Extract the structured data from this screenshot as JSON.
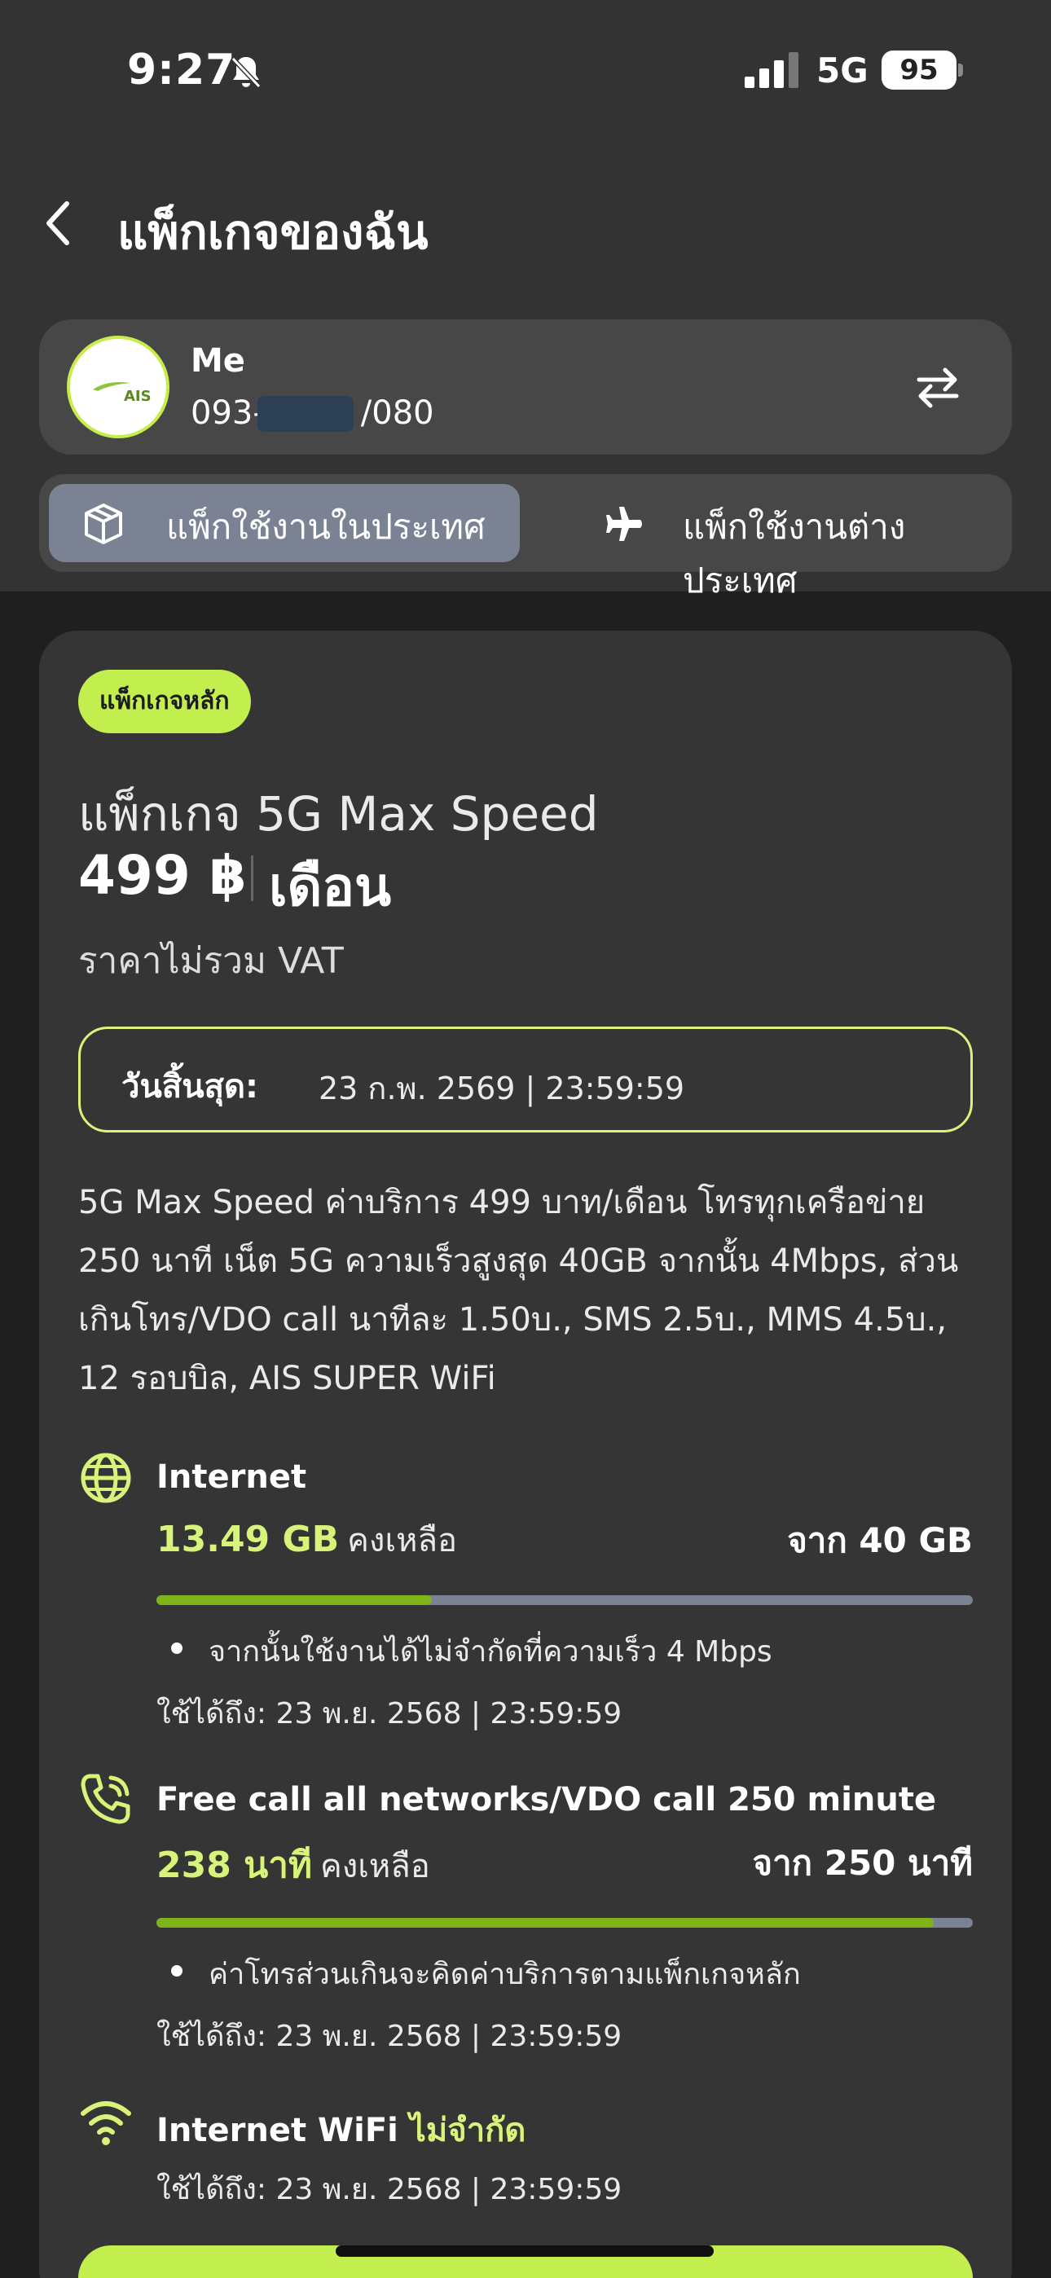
{
  "status_bar": {
    "time": "9:27",
    "network": "5G",
    "battery": "95"
  },
  "header": {
    "title": "แพ็กเกจของฉัน"
  },
  "account": {
    "name": "Me",
    "number_prefix": "093-",
    "number_suffix": "/080",
    "logo_text": "AIS"
  },
  "tabs": [
    {
      "label": "แพ็กใช้งานในประเทศ",
      "icon": "box-icon",
      "selected": true
    },
    {
      "label": "แพ็กใช้งานต่างประเทศ",
      "icon": "airplane-icon",
      "selected": false
    }
  ],
  "package": {
    "badge": "แพ็กเกจหลัก",
    "name": "แพ็กเกจ 5G Max Speed",
    "price": "499 ฿",
    "price_unit": "เดือน",
    "vat_note": "ราคาไม่รวม VAT",
    "expiry_label": "วันสิ้นสุด:",
    "expiry_value": "23 ก.พ. 2569 | 23:59:59",
    "description": "5G Max Speed ค่าบริการ 499 บาท/เดือน โทรทุกเครือข่าย 250 นาที เน็ต 5G ความเร็วสูงสุด 40GB จากนั้น 4Mbps, ส่วนเกินโทร/VDO call นาทีละ 1.50บ., SMS 2.5บ., MMS 4.5บ., 12 รอบบิล, AIS SUPER WiFi"
  },
  "internet": {
    "title": "Internet",
    "remaining": "13.49 GB",
    "remaining_suffix": "คงเหลือ",
    "total": "จาก 40 GB",
    "fraction_remaining": 0.337,
    "note": "จากนั้นใช้งานได้ไม่จำกัดที่ความเร็ว 4 Mbps",
    "valid_until": "ใช้ได้ถึง: 23 พ.ย. 2568 | 23:59:59"
  },
  "calls": {
    "title": "Free call all networks/VDO call 250 minute",
    "remaining": "238 นาที",
    "remaining_suffix": "คงเหลือ",
    "total": "จาก 250 นาที",
    "fraction_remaining": 0.952,
    "note": "ค่าโทรส่วนเกินจะคิดค่าบริการตามแพ็กเกจหลัก",
    "valid_until": "ใช้ได้ถึง: 23 พ.ย. 2568 | 23:59:59"
  },
  "wifi": {
    "title": "Internet WiFi",
    "title_accent": "ไม่จำกัด",
    "valid_until": "ใช้ได้ถึง: 23 พ.ย. 2568 | 23:59:59"
  },
  "colors": {
    "accent": "#d8f27a",
    "badge": "#c3ef4e",
    "progress_fill": "#7fb31a",
    "progress_track": "#7a8294"
  }
}
